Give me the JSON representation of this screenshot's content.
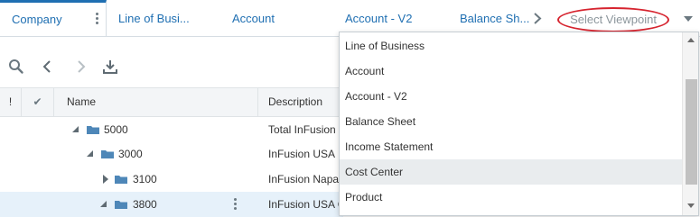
{
  "tabs": [
    {
      "label": "Company",
      "active": true
    },
    {
      "label": "Line of Busi..."
    },
    {
      "label": "Account"
    },
    {
      "label": "Account - V2"
    },
    {
      "label": "Balance Sh..."
    }
  ],
  "viewpoint_selector": {
    "placeholder": "Select Viewpoint",
    "highlight_color": "#d6242f"
  },
  "toolbar": {
    "icons": [
      "search-icon",
      "back-arrow-icon",
      "forward-arrow-icon",
      "download-icon"
    ]
  },
  "grid": {
    "columns": {
      "flag": "!",
      "check": "✔",
      "name": "Name",
      "description": "Description"
    },
    "rows": [
      {
        "name": "5000",
        "description": "Total InFusion C",
        "state": "expanded"
      },
      {
        "name": "3000",
        "description": "InFusion USA",
        "state": "expanded"
      },
      {
        "name": "3100",
        "description": "InFusion Napa",
        "state": "collapsed"
      },
      {
        "name": "3800",
        "description": "InFusion USA C",
        "state": "expanded",
        "selected": true
      }
    ]
  },
  "dropdown": {
    "items": [
      "Line of Business",
      "Account",
      "Account - V2",
      "Balance Sheet",
      "Income Statement",
      "Cost Center",
      "Product"
    ],
    "hovered": "Cost Center"
  },
  "colors": {
    "accent": "#1f6fb2",
    "folder": "#4e87b8",
    "selected_row": "#e6f1fa"
  }
}
